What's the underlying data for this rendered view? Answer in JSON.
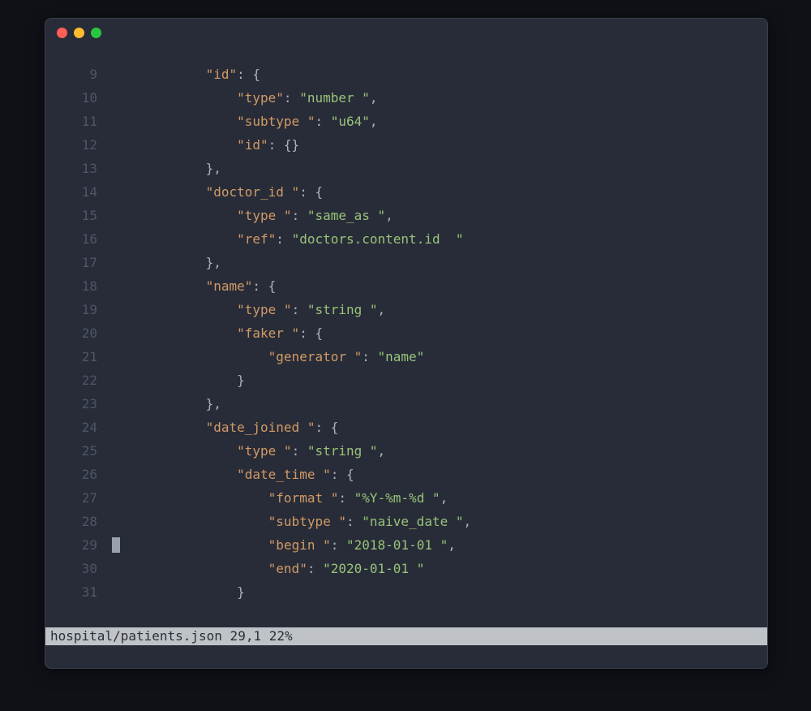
{
  "window": {
    "traffic_colors": {
      "close": "#ff5f57",
      "min": "#febc2e",
      "max": "#28c840"
    }
  },
  "statusbar": {
    "text": "hospital/patients.json 29,1 22%"
  },
  "cursor": {
    "line": 29,
    "col": 1
  },
  "lines": [
    {
      "num": "9",
      "indent": "            ",
      "tokens": [
        {
          "t": "key",
          "v": "\"id\""
        },
        {
          "t": "punct",
          "v": ": {"
        }
      ]
    },
    {
      "num": "10",
      "indent": "                ",
      "tokens": [
        {
          "t": "key",
          "v": "\"type\""
        },
        {
          "t": "punct",
          "v": ": "
        },
        {
          "t": "str",
          "v": "\"number \""
        },
        {
          "t": "punct",
          "v": ","
        }
      ]
    },
    {
      "num": "11",
      "indent": "                ",
      "tokens": [
        {
          "t": "key",
          "v": "\"subtype \""
        },
        {
          "t": "punct",
          "v": ": "
        },
        {
          "t": "str",
          "v": "\"u64\""
        },
        {
          "t": "punct",
          "v": ","
        }
      ]
    },
    {
      "num": "12",
      "indent": "                ",
      "tokens": [
        {
          "t": "key",
          "v": "\"id\""
        },
        {
          "t": "punct",
          "v": ": {}"
        }
      ]
    },
    {
      "num": "13",
      "indent": "            ",
      "tokens": [
        {
          "t": "punct",
          "v": "},"
        }
      ]
    },
    {
      "num": "14",
      "indent": "            ",
      "tokens": [
        {
          "t": "key",
          "v": "\"doctor_id \""
        },
        {
          "t": "punct",
          "v": ": {"
        }
      ]
    },
    {
      "num": "15",
      "indent": "                ",
      "tokens": [
        {
          "t": "key",
          "v": "\"type \""
        },
        {
          "t": "punct",
          "v": ": "
        },
        {
          "t": "str",
          "v": "\"same_as \""
        },
        {
          "t": "punct",
          "v": ","
        }
      ]
    },
    {
      "num": "16",
      "indent": "                ",
      "tokens": [
        {
          "t": "key",
          "v": "\"ref\""
        },
        {
          "t": "punct",
          "v": ": "
        },
        {
          "t": "str",
          "v": "\"doctors.content.id  \""
        }
      ]
    },
    {
      "num": "17",
      "indent": "            ",
      "tokens": [
        {
          "t": "punct",
          "v": "},"
        }
      ]
    },
    {
      "num": "18",
      "indent": "            ",
      "tokens": [
        {
          "t": "key",
          "v": "\"name\""
        },
        {
          "t": "punct",
          "v": ": {"
        }
      ]
    },
    {
      "num": "19",
      "indent": "                ",
      "tokens": [
        {
          "t": "key",
          "v": "\"type \""
        },
        {
          "t": "punct",
          "v": ": "
        },
        {
          "t": "str",
          "v": "\"string \""
        },
        {
          "t": "punct",
          "v": ","
        }
      ]
    },
    {
      "num": "20",
      "indent": "                ",
      "tokens": [
        {
          "t": "key",
          "v": "\"faker \""
        },
        {
          "t": "punct",
          "v": ": {"
        }
      ]
    },
    {
      "num": "21",
      "indent": "                    ",
      "tokens": [
        {
          "t": "key",
          "v": "\"generator \""
        },
        {
          "t": "punct",
          "v": ": "
        },
        {
          "t": "str",
          "v": "\"name\""
        }
      ]
    },
    {
      "num": "22",
      "indent": "                ",
      "tokens": [
        {
          "t": "punct",
          "v": "}"
        }
      ]
    },
    {
      "num": "23",
      "indent": "            ",
      "tokens": [
        {
          "t": "punct",
          "v": "},"
        }
      ]
    },
    {
      "num": "24",
      "indent": "            ",
      "tokens": [
        {
          "t": "key",
          "v": "\"date_joined \""
        },
        {
          "t": "punct",
          "v": ": {"
        }
      ]
    },
    {
      "num": "25",
      "indent": "                ",
      "tokens": [
        {
          "t": "key",
          "v": "\"type \""
        },
        {
          "t": "punct",
          "v": ": "
        },
        {
          "t": "str",
          "v": "\"string \""
        },
        {
          "t": "punct",
          "v": ","
        }
      ]
    },
    {
      "num": "26",
      "indent": "                ",
      "tokens": [
        {
          "t": "key",
          "v": "\"date_time \""
        },
        {
          "t": "punct",
          "v": ": {"
        }
      ]
    },
    {
      "num": "27",
      "indent": "                    ",
      "tokens": [
        {
          "t": "key",
          "v": "\"format \""
        },
        {
          "t": "punct",
          "v": ": "
        },
        {
          "t": "str",
          "v": "\"%Y-%m-%d \""
        },
        {
          "t": "punct",
          "v": ","
        }
      ]
    },
    {
      "num": "28",
      "indent": "                    ",
      "tokens": [
        {
          "t": "key",
          "v": "\"subtype \""
        },
        {
          "t": "punct",
          "v": ": "
        },
        {
          "t": "str",
          "v": "\"naive_date \""
        },
        {
          "t": "punct",
          "v": ","
        }
      ]
    },
    {
      "num": "29",
      "indent": "                    ",
      "tokens": [
        {
          "t": "key",
          "v": "\"begin \""
        },
        {
          "t": "punct",
          "v": ": "
        },
        {
          "t": "str",
          "v": "\"2018-01-01 \""
        },
        {
          "t": "punct",
          "v": ","
        }
      ]
    },
    {
      "num": "30",
      "indent": "                    ",
      "tokens": [
        {
          "t": "key",
          "v": "\"end\""
        },
        {
          "t": "punct",
          "v": ": "
        },
        {
          "t": "str",
          "v": "\"2020-01-01 \""
        }
      ]
    },
    {
      "num": "31",
      "indent": "                ",
      "tokens": [
        {
          "t": "punct",
          "v": "}"
        }
      ]
    }
  ]
}
